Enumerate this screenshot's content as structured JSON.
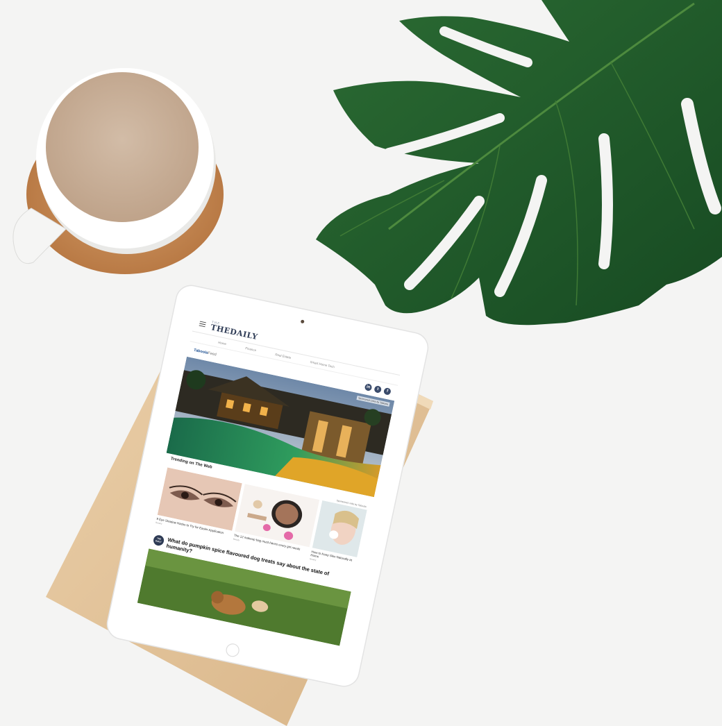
{
  "screen": {
    "logo_small": "THE",
    "logo": "THEDAILY",
    "nav": [
      "Home",
      "Finance",
      "Real Estate",
      "Smart Home Tech"
    ],
    "feed_brand": "Taboola",
    "feed_brand_suffix": "Feed",
    "socials": [
      "in",
      "t",
      "f"
    ],
    "hero_sponsor": "Sponsored Links by Taboola",
    "trending_title": "Trending on The Web",
    "trending_sponsor": "Sponsored Links by Taboola",
    "cards": [
      {
        "caption": "9 Eye Shadow Hacks to Try for Easier Application",
        "source": "Beauty"
      },
      {
        "caption": "The 12 makeup bag must-haves every girl needs",
        "source": "Beauty"
      },
      {
        "caption": "How to Keep Skin Naturally at Home",
        "source": "Beauty"
      }
    ],
    "article_badge": "THE DAILY",
    "article_headline": "What do pumpkin spice flavoured dog treats say about the state of humanity?"
  },
  "colors": {
    "background": "#f4f4f3",
    "leaf": "#1f5a2a",
    "cork": "#c48a55",
    "coffee": "#cbb29b",
    "board": "#e2c39a",
    "brand_blue": "#1d4f91",
    "navy": "#2e3b55"
  }
}
